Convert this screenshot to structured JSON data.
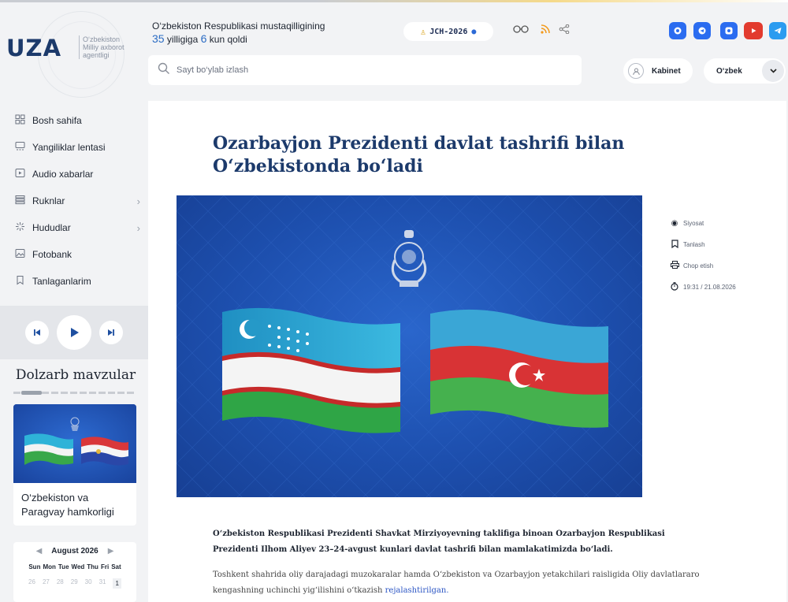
{
  "brand": {
    "logo": "UZA",
    "subtitle_line1": "O‘zbekiston",
    "subtitle_line2": "Milliy axborot",
    "subtitle_line3": "agentligi"
  },
  "header": {
    "independence_text": "O‘zbekiston Respublikasi mustaqilligining",
    "years": "35",
    "years_label": "yilligiga",
    "days": "6",
    "days_label": "kun qoldi",
    "jch_label": "JCH-2026",
    "icons": [
      "glasses-icon",
      "rss-icon",
      "share-icon"
    ],
    "social": [
      {
        "name": "odnoklassniki",
        "color": "#2b6cf0",
        "glyph": "o"
      },
      {
        "name": "telegram-circle",
        "color": "#2b6cf0",
        "glyph": "◉"
      },
      {
        "name": "instagram",
        "color": "#2b6cf0",
        "glyph": "◘"
      },
      {
        "name": "youtube",
        "color": "#e23b2e",
        "glyph": "▶"
      },
      {
        "name": "telegram",
        "color": "#2b9cf0",
        "glyph": "➤"
      }
    ]
  },
  "search": {
    "placeholder": "Sayt bo‘ylab izlash"
  },
  "account": {
    "cabinet_label": "Kabinet",
    "language": "O‘zbek"
  },
  "nav": {
    "items": [
      {
        "label": "Bosh sahifa",
        "icon": "grid-icon",
        "glyph": "▦"
      },
      {
        "label": "Yangiliklar lentasi",
        "icon": "feed-icon",
        "glyph": "▭"
      },
      {
        "label": "Audio xabarlar",
        "icon": "audio-icon",
        "glyph": "▷"
      },
      {
        "label": "Ruknlar",
        "icon": "layers-icon",
        "glyph": "≣",
        "arrow": "›"
      },
      {
        "label": "Hududlar",
        "icon": "region-icon",
        "glyph": "✳",
        "arrow": "›"
      },
      {
        "label": "Fotobank",
        "icon": "image-icon",
        "glyph": "▨"
      },
      {
        "label": "Tanlaganlarim",
        "icon": "bookmark-icon",
        "glyph": "◻"
      }
    ]
  },
  "trending": {
    "title": "Dolzarb mavzular",
    "card_title": "O‘zbekiston va Paragvay hamkorligi"
  },
  "calendar": {
    "month": "August 2026",
    "weekdays": [
      "Sun",
      "Mon",
      "Tue",
      "Wed",
      "Thu",
      "Fri",
      "Sat"
    ],
    "first_row": [
      "26",
      "27",
      "28",
      "29",
      "30",
      "31",
      "1"
    ]
  },
  "article": {
    "title": "Ozarbayjon Prezidenti davlat tashrifi bilan O‘zbekistonda bo‘ladi",
    "category": "Siyosat",
    "bookmark_label": "Tanlash",
    "print_label": "Chop etish",
    "datetime": "19:31 / 21.08.2026",
    "lead": "O‘zbekiston Respublikasi Prezidenti Shavkat Mirziyoyevning taklifiga binoan Ozarbayjon Respublikasi Prezidenti Ilhom Aliyev 23–24-avgust kunlari davlat tashrifi bilan mamlakatimizda bo‘ladi.",
    "para_text": "Toshkent shahrida oliy darajadagi muzokaralar hamda O‘zbekiston va Ozarbayjon yetakchilari raisligida Oliy davlatlararo kengashning uchinchi yig‘ilishini o‘tkazish ",
    "para_link": "rejalashtirilgan."
  }
}
